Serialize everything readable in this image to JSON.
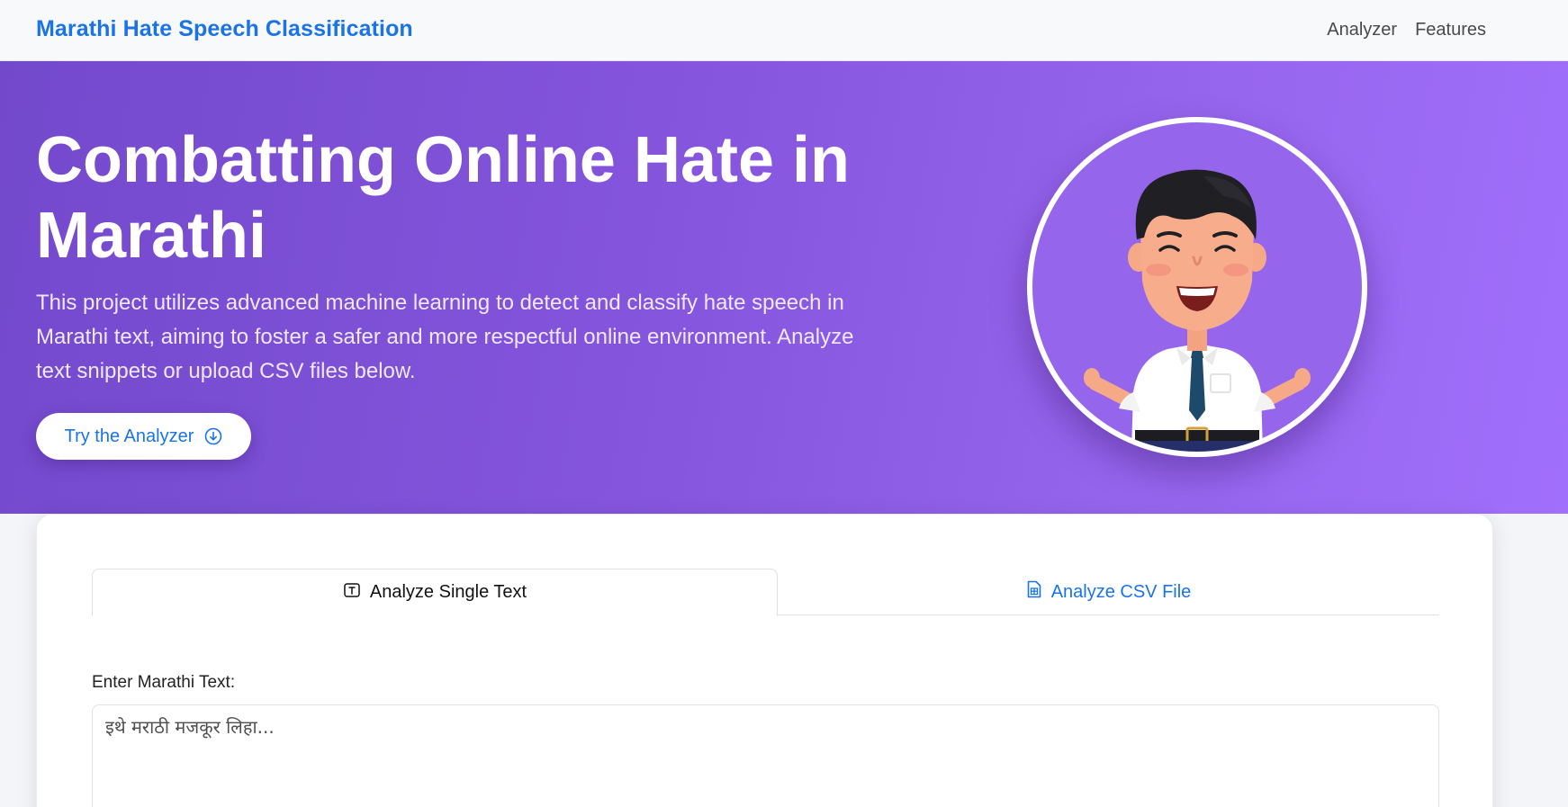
{
  "navbar": {
    "brand": "Marathi Hate Speech Classification",
    "links": [
      "Analyzer",
      "Features"
    ]
  },
  "hero": {
    "title": "Combatting Online Hate in Marathi",
    "description": "This project utilizes advanced machine learning to detect and classify hate speech in Marathi text, aiming to foster a safer and more respectful online environment. Analyze text snippets or upload CSV files below.",
    "button_label": "Try the Analyzer",
    "button_icon": "arrow-down-circle-icon",
    "illustration": "smiling-man-avatar"
  },
  "analyzer": {
    "tabs": [
      {
        "label": "Analyze Single Text",
        "icon": "text-input-icon",
        "active": true
      },
      {
        "label": "Analyze CSV File",
        "icon": "spreadsheet-file-icon",
        "active": false
      }
    ],
    "input_label": "Enter Marathi Text:",
    "input_placeholder": "इथे मराठी मजकूर लिहा..."
  },
  "colors": {
    "brand": "#1a73e8",
    "hero_gradient_start": "#7349cc",
    "hero_gradient_end": "#a06ffc",
    "navbar_bg": "#f8f9fa",
    "card_bg": "#ffffff"
  }
}
